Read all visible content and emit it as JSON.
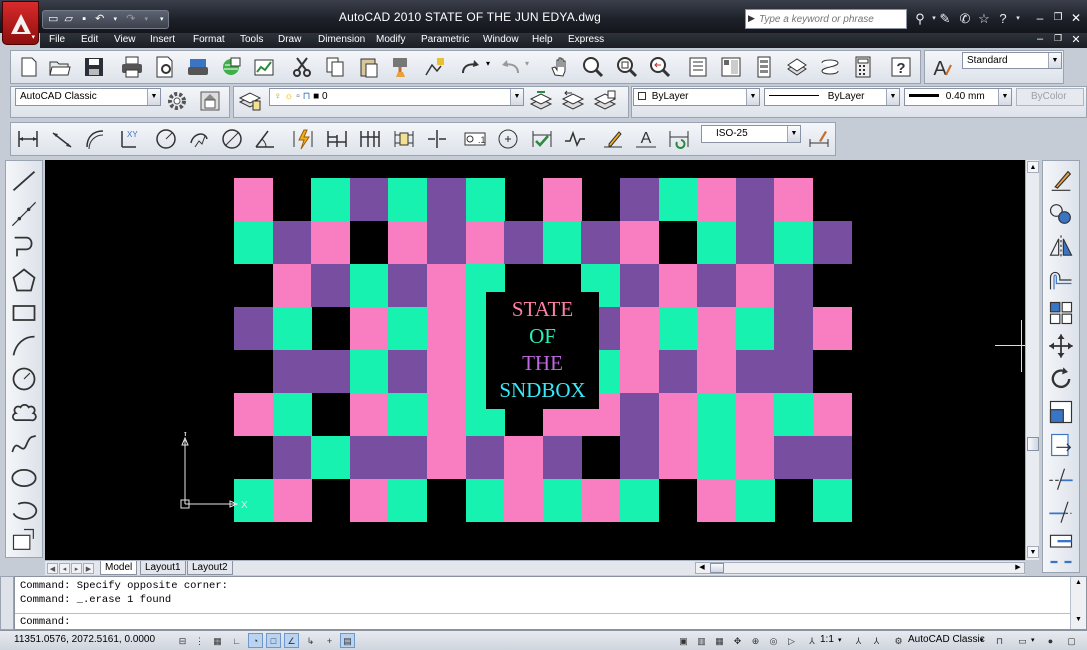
{
  "window": {
    "title": "AutoCAD 2010    STATE OF THE JUN EDYA.dwg",
    "search_placeholder": "Type a keyword or phrase"
  },
  "menu": [
    "File",
    "Edit",
    "View",
    "Insert",
    "Format",
    "Tools",
    "Draw",
    "Dimension",
    "Modify",
    "Parametric",
    "Window",
    "Help",
    "Express"
  ],
  "toolbars": {
    "text_style": "Standard",
    "workspace": "AutoCAD Classic",
    "layer": "0",
    "color": "ByLayer",
    "linetype": "ByLayer",
    "lineweight": "0.40 mm",
    "plotstyle": "ByColor",
    "dim_style": "ISO-25"
  },
  "drawing": {
    "title_lines": [
      {
        "text": "STATE",
        "color": "#ff7fa8"
      },
      {
        "text": "OF",
        "color": "#28f0b8"
      },
      {
        "text": "THE",
        "color": "#c068e0"
      },
      {
        "text": "SNDBOX",
        "color": "#38e8f8"
      }
    ],
    "ucs_labels": {
      "x": "X",
      "y": "Y"
    },
    "palette": {
      "pink": "#f87ec1",
      "teal": "#17f2b0",
      "purple": "#784fa0",
      "black": "#000000"
    },
    "grid": [
      "P.TUTUT.P.UTPUP.",
      "TUP.PUPUTUP.TUTU",
      ".PUTUPT..TUPUPU.",
      "UT.PTPT..UPTPTUP",
      ".UUTUPT..TPUPUU.",
      "PT.PTPT.PPUPTPTP",
      ".UTUUPUPU.UPTPUU",
      "TP.PT.TPTPT.PT.T"
    ]
  },
  "tabs": {
    "model": "Model",
    "layout1": "Layout1",
    "layout2": "Layout2"
  },
  "command": {
    "history": [
      "Command: Specify opposite corner:",
      "Command: _.erase 1 found"
    ],
    "prompt": "Command:"
  },
  "status": {
    "coords": "11351.0576, 2072.5161, 0.0000",
    "annotation_scale": "1:1",
    "workspace": "AutoCAD Classic"
  }
}
